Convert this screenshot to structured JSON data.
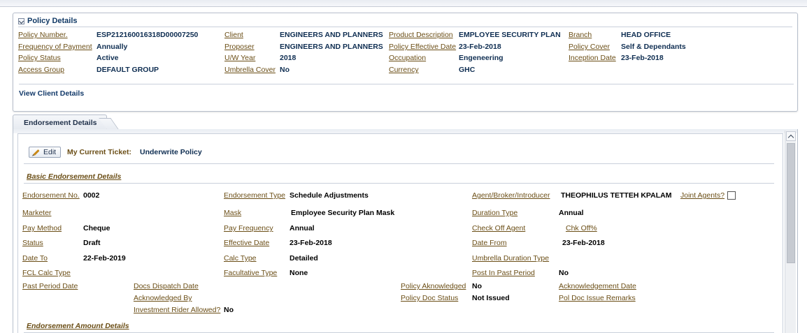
{
  "policy_panel": {
    "title": "Policy Details",
    "fields": {
      "policy_number": {
        "label": "Policy Number.",
        "value": "ESP212160016318D00007250"
      },
      "frequency_of_payment": {
        "label": "Frequency of Payment",
        "value": "Annually"
      },
      "policy_status": {
        "label": "Policy Status",
        "value": "Active"
      },
      "access_group": {
        "label": "Access Group",
        "value": "DEFAULT GROUP"
      },
      "client": {
        "label": "Client",
        "value": "ENGINEERS AND PLANNERS"
      },
      "proposer": {
        "label": "Proposer",
        "value": "ENGINEERS AND PLANNERS"
      },
      "uw_year": {
        "label": "U/W Year",
        "value": "2018"
      },
      "umbrella_cover": {
        "label": "Umbrella Cover",
        "value": "No"
      },
      "product_description": {
        "label": "Product Description",
        "value": "EMPLOYEE SECURITY PLAN"
      },
      "policy_effective_date": {
        "label": "Policy Effective Date",
        "value": "23-Feb-2018"
      },
      "occupation": {
        "label": "Occupation",
        "value": "Engeneering"
      },
      "currency": {
        "label": "Currency",
        "value": "GHC"
      },
      "branch": {
        "label": "Branch",
        "value": "HEAD OFFICE"
      },
      "policy_cover": {
        "label": "Policy Cover",
        "value": "Self & Dependants"
      },
      "inception_date": {
        "label": "Inception Date",
        "value": "23-Feb-2018"
      }
    },
    "view_client_link": "View Client Details"
  },
  "endorsement_tab": {
    "label": "Endorsement Details",
    "edit_button": "Edit",
    "ticket_label": "My Current Ticket:",
    "ticket_value": "Underwrite Policy",
    "basic_section_title": "Basic Endorsement Details",
    "amount_section_title": "Endorsement Amount Details",
    "fields": {
      "endorsement_no": {
        "label": "Endorsement No.",
        "value": "0002"
      },
      "marketer": {
        "label": "Marketer",
        "value": ""
      },
      "pay_method": {
        "label": "Pay Method",
        "value": "Cheque"
      },
      "status": {
        "label": "Status",
        "value": "Draft"
      },
      "date_to": {
        "label": "Date To",
        "value": "22-Feb-2019"
      },
      "fcl_calc_type": {
        "label": "FCL Calc Type",
        "value": ""
      },
      "past_period_date": {
        "label": "Past Period Date",
        "value": ""
      },
      "endorsement_type": {
        "label": "Endorsement Type",
        "value": "Schedule Adjustments"
      },
      "mask": {
        "label": "Mask",
        "value": "Employee Security Plan Mask"
      },
      "pay_frequency": {
        "label": "Pay Frequency",
        "value": "Annual"
      },
      "effective_date": {
        "label": "Effective Date",
        "value": "23-Feb-2018"
      },
      "calc_type": {
        "label": "Calc Type",
        "value": "Detailed"
      },
      "facultative_type": {
        "label": "Facultative Type",
        "value": "None"
      },
      "docs_dispatch_date": {
        "label": "Docs Dispatch Date",
        "value": ""
      },
      "acknowledged_by": {
        "label": "Acknowledged By",
        "value": ""
      },
      "investment_rider": {
        "label": "Investment Rider Allowed?",
        "value": "No"
      },
      "policy_acknowledged": {
        "label": "Policy Aknowledged",
        "value": "No"
      },
      "policy_doc_status": {
        "label": "Policy Doc Status",
        "value": "Not Issued"
      },
      "agent": {
        "label": "Agent/Broker/Introducer",
        "value": "THEOPHILUS TETTEH KPALAM"
      },
      "joint_agents": {
        "label": "Joint Agents?"
      },
      "duration_type": {
        "label": "Duration Type",
        "value": "Annual"
      },
      "check_off_agent": {
        "label": "Check Off Agent",
        "value": ""
      },
      "chk_off_pct": {
        "label": "Chk Off%",
        "value": ""
      },
      "date_from": {
        "label": "Date From",
        "value": "23-Feb-2018"
      },
      "umbrella_duration_type": {
        "label": "Umbrella Duration Type",
        "value": ""
      },
      "post_in_past_period": {
        "label": "Post In Past Period",
        "value": "No"
      },
      "acknowledgement_date": {
        "label": "Acknowledgement Date",
        "value": ""
      },
      "pol_doc_issue_remarks": {
        "label": "Pol Doc Issue Remarks",
        "value": ""
      }
    }
  },
  "colors": {
    "label": "#6b4e16",
    "value": "#0f2e52",
    "panel_border": "#b7bfcc"
  },
  "icons": [
    "collapse-toggle-icon",
    "pencil-icon",
    "scroll-up-icon"
  ]
}
